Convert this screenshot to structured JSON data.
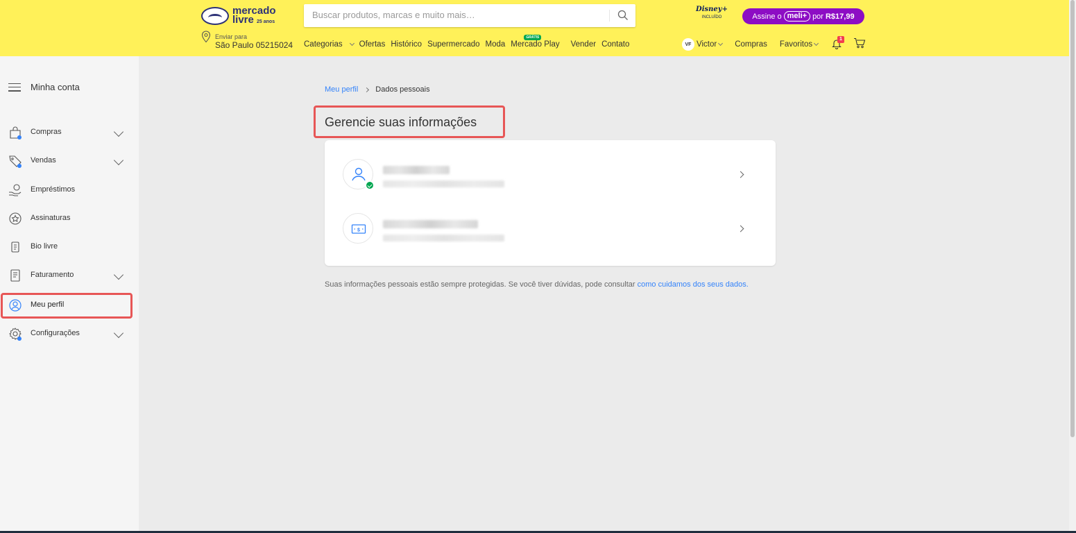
{
  "header": {
    "logo_line1": "mercado",
    "logo_line2": "livre",
    "logo_badge": "25 anos",
    "search_placeholder": "Buscar produtos, marcas e muito mais…",
    "disney_label": "Disney+",
    "disney_sub": "INCLUÍDO",
    "meli_prefix": "Assine o",
    "meli_name": "meli+",
    "meli_por": "por",
    "meli_price": "R$17,99",
    "location_label": "Enviar para",
    "location_value": "São Paulo 05215024",
    "nav": [
      "Categorias",
      "Ofertas",
      "Histórico",
      "Supermercado",
      "Moda",
      "Mercado Play",
      "Vender",
      "Contato"
    ],
    "gratis_badge": "GRÁTIS",
    "user_initials": "VF",
    "user_name": "Victor",
    "compras": "Compras",
    "favoritos": "Favoritos",
    "notif_count": "1",
    "accent_color": "#fff159"
  },
  "sidebar": {
    "title": "Minha conta",
    "items": [
      {
        "label": "Compras",
        "icon": "shopping-bag-icon",
        "expandable": true
      },
      {
        "label": "Vendas",
        "icon": "tag-icon",
        "expandable": true
      },
      {
        "label": "Empréstimos",
        "icon": "money-hand-icon",
        "expandable": false
      },
      {
        "label": "Assinaturas",
        "icon": "star-badge-icon",
        "expandable": false
      },
      {
        "label": "Bio livre",
        "icon": "bio-icon",
        "expandable": false
      },
      {
        "label": "Faturamento",
        "icon": "invoice-icon",
        "expandable": true
      },
      {
        "label": "Meu perfil",
        "icon": "user-circle-icon",
        "expandable": false,
        "active": true
      },
      {
        "label": "Configurações",
        "icon": "gear-icon",
        "expandable": true
      }
    ]
  },
  "main": {
    "breadcrumb_link": "Meu perfil",
    "breadcrumb_current": "Dados pessoais",
    "page_title": "Gerencie suas informações",
    "rows": [
      {
        "icon": "user-icon",
        "verified": true
      },
      {
        "icon": "money-bill-icon",
        "verified": false
      }
    ],
    "note_text": "Suas informações pessoais estão sempre protegidas. Se você tiver dúvidas, pode consultar ",
    "note_link": "como cuidamos dos seus dados."
  }
}
